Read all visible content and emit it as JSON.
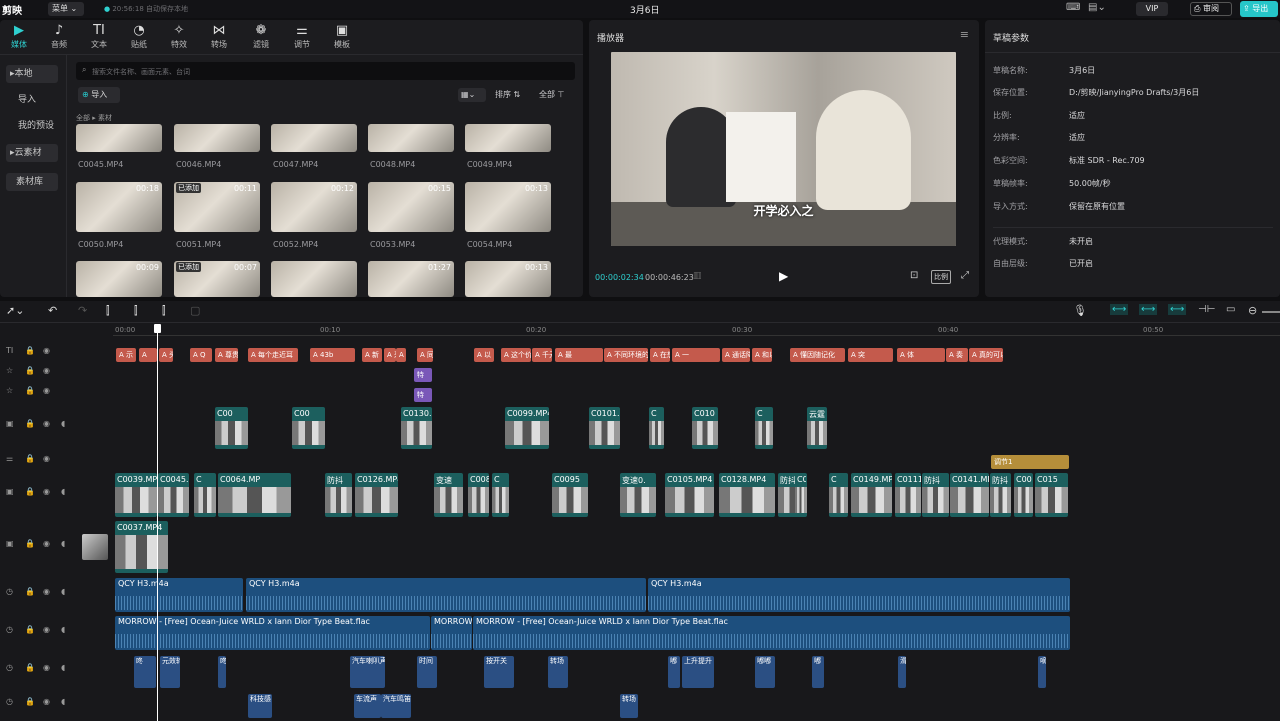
{
  "titlebar": {
    "app": "剪映",
    "menu": "菜单",
    "saved": "20:56:18 自动保存本地",
    "project_title": "3月6日",
    "vip": "VIP",
    "review": "审阅",
    "export": "导出"
  },
  "tabs": [
    {
      "icon": "media-icon",
      "glyph": "▶",
      "label": "媒体"
    },
    {
      "icon": "audio-icon",
      "glyph": "♪",
      "label": "音频"
    },
    {
      "icon": "text-icon",
      "glyph": "TI",
      "label": "文本"
    },
    {
      "icon": "sticker-icon",
      "glyph": "◔",
      "label": "贴纸"
    },
    {
      "icon": "effect-icon",
      "glyph": "✧",
      "label": "特效"
    },
    {
      "icon": "transition-icon",
      "glyph": "⋈",
      "label": "转场"
    },
    {
      "icon": "filter-icon",
      "glyph": "❁",
      "label": "滤镜"
    },
    {
      "icon": "adjust-icon",
      "glyph": "⚌",
      "label": "调节"
    },
    {
      "icon": "template-icon",
      "glyph": "▣",
      "label": "模板"
    }
  ],
  "sidebar": [
    {
      "label": "本地"
    },
    {
      "label": "导入"
    },
    {
      "label": "我的预设"
    },
    {
      "label": "云素材"
    },
    {
      "label": "素材库"
    }
  ],
  "media": {
    "search_placeholder": "搜索文件名称、画面元素、台词",
    "import": "导入",
    "sort": "排序",
    "filter": "全部",
    "crumb_all": "全部",
    "crumb_sub": "素材",
    "row1": [
      "C0045.MP4",
      "C0046.MP4",
      "C0047.MP4",
      "C0048.MP4",
      "C0049.MP4"
    ],
    "row2": [
      {
        "name": "C0050.MP4",
        "dur": "00:18",
        "tag": ""
      },
      {
        "name": "C0051.MP4",
        "dur": "00:11",
        "tag": "已添加"
      },
      {
        "name": "C0052.MP4",
        "dur": "00:12",
        "tag": ""
      },
      {
        "name": "C0053.MP4",
        "dur": "00:15",
        "tag": ""
      },
      {
        "name": "C0054.MP4",
        "dur": "00:13",
        "tag": ""
      }
    ],
    "row3": [
      {
        "dur": "00:09",
        "tag": ""
      },
      {
        "dur": "00:07",
        "tag": "已添加"
      },
      {
        "dur": "",
        "tag": ""
      },
      {
        "dur": "01:27",
        "tag": ""
      },
      {
        "dur": "00:13",
        "tag": ""
      }
    ]
  },
  "player": {
    "title": "播放器",
    "subtitle": "开学必入之",
    "current": "00:00:02:34",
    "total": "00:00:46:23",
    "ratio": "比例"
  },
  "props": {
    "title": "草稿参数",
    "rows": [
      {
        "k": "草稿名称:",
        "v": "3月6日"
      },
      {
        "k": "保存位置:",
        "v": "D:/剪映/JianyingPro Drafts/3月6日"
      },
      {
        "k": "比例:",
        "v": "适应"
      },
      {
        "k": "分辨率:",
        "v": "适应"
      },
      {
        "k": "色彩空间:",
        "v": "标准 SDR - Rec.709"
      },
      {
        "k": "草稿帧率:",
        "v": "50.00帧/秒"
      },
      {
        "k": "导入方式:",
        "v": "保留在原有位置"
      },
      {
        "k": "代理模式:",
        "v": "未开启"
      },
      {
        "k": "自由层级:",
        "v": "已开启"
      }
    ]
  },
  "ruler": [
    "00:00",
    "00:10",
    "00:20",
    "00:30",
    "00:40",
    "00:50"
  ],
  "text_clips": [
    "A 示",
    "A",
    "A 头",
    "A Q",
    "A 尊贵的Hai",
    "A 每个走近耳",
    "A 43b",
    "A 新",
    "A 采",
    "A",
    "A 同时支持",
    "A 以",
    "A 这个价位",
    "A 千元耳机",
    "A 最",
    "A 不同环境的",
    "A 在想",
    "A 一",
    "A 通话降噪的",
    "A 和以及",
    "A 懂因随记化",
    "A 突",
    "A 体",
    "A 奏",
    "A 真的可以说"
  ],
  "effect_label": "特",
  "overlay_clips": [
    "C00",
    "C00",
    "C0130.M",
    "C0099.MP4",
    "C0101.M",
    "C",
    "C010",
    "C",
    "云霆"
  ],
  "adjust_label": "调节1",
  "main_clips": [
    "C0039.MP4",
    "C0045.MP",
    "C",
    "C0064.MP",
    "防抖",
    "C0126.MP4",
    "变速",
    "C008",
    "C",
    "C0095",
    "变速0.",
    "C0105.MP4",
    "C0128.MP4",
    "防抖",
    "C0",
    "C",
    "C0149.MP4",
    "C0111.",
    "防抖",
    "C0141.MP4",
    "防抖",
    "C00",
    "C015"
  ],
  "main_track": {
    "clip": "C0037.MP4",
    "extra": "0"
  },
  "audio1": [
    "QCY H3.m4a",
    "QCY H3.m4a",
    "QCY H3.m4a"
  ],
  "audio2": [
    "MORROW - [Free] Ocean-Juice WRLD x Iann Dior Type Beat.flac",
    "MORROW",
    "MORROW - [Free] Ocean-Juice WRLD x Iann Dior Type Beat.flac"
  ],
  "sfx1": [
    "咚",
    "元效转",
    "咚",
    "汽车喇叭声",
    "时间",
    "按开关",
    "转场",
    "嘟",
    "上升提升",
    "嘟嘟",
    "嘟",
    "滑",
    "嘀"
  ],
  "sfx2": [
    "科技感",
    "车流声",
    "汽车鸣笛",
    "转场"
  ]
}
